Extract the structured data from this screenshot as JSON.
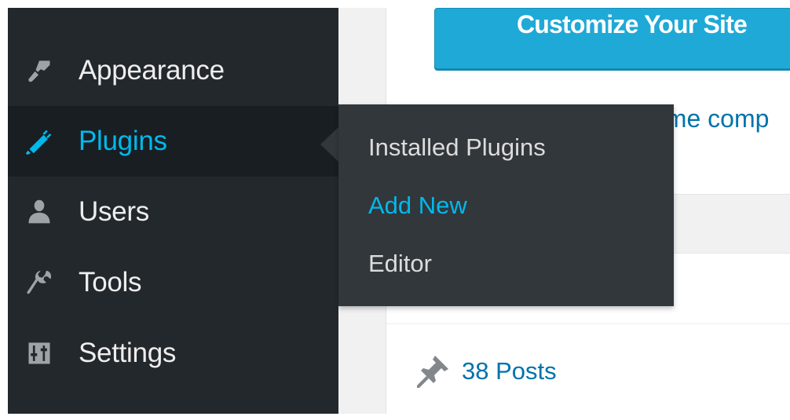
{
  "sidebar": {
    "items": [
      {
        "label": "Appearance",
        "icon": "paintbrush-icon",
        "active": false
      },
      {
        "label": "Plugins",
        "icon": "plug-icon",
        "active": true
      },
      {
        "label": "Users",
        "icon": "user-icon",
        "active": false
      },
      {
        "label": "Tools",
        "icon": "wrench-icon",
        "active": false
      },
      {
        "label": "Settings",
        "icon": "settings-sliders-icon",
        "active": false
      }
    ]
  },
  "submenu": {
    "items": [
      {
        "label": "Installed Plugins",
        "current": false
      },
      {
        "label": "Add New",
        "current": true
      },
      {
        "label": "Editor",
        "current": false
      }
    ]
  },
  "main": {
    "customize_button_label": "Customize Your Site",
    "partial_link_text": "eme comp",
    "posts_count_label": "38 Posts",
    "posts_icon": "pushpin-icon"
  },
  "colors": {
    "sidebar_bg": "#23282d",
    "active_item_bg": "#191e23",
    "flyout_bg": "#32373c",
    "accent": "#00b9eb",
    "link": "#0073aa",
    "button": "#1fa9d6"
  }
}
